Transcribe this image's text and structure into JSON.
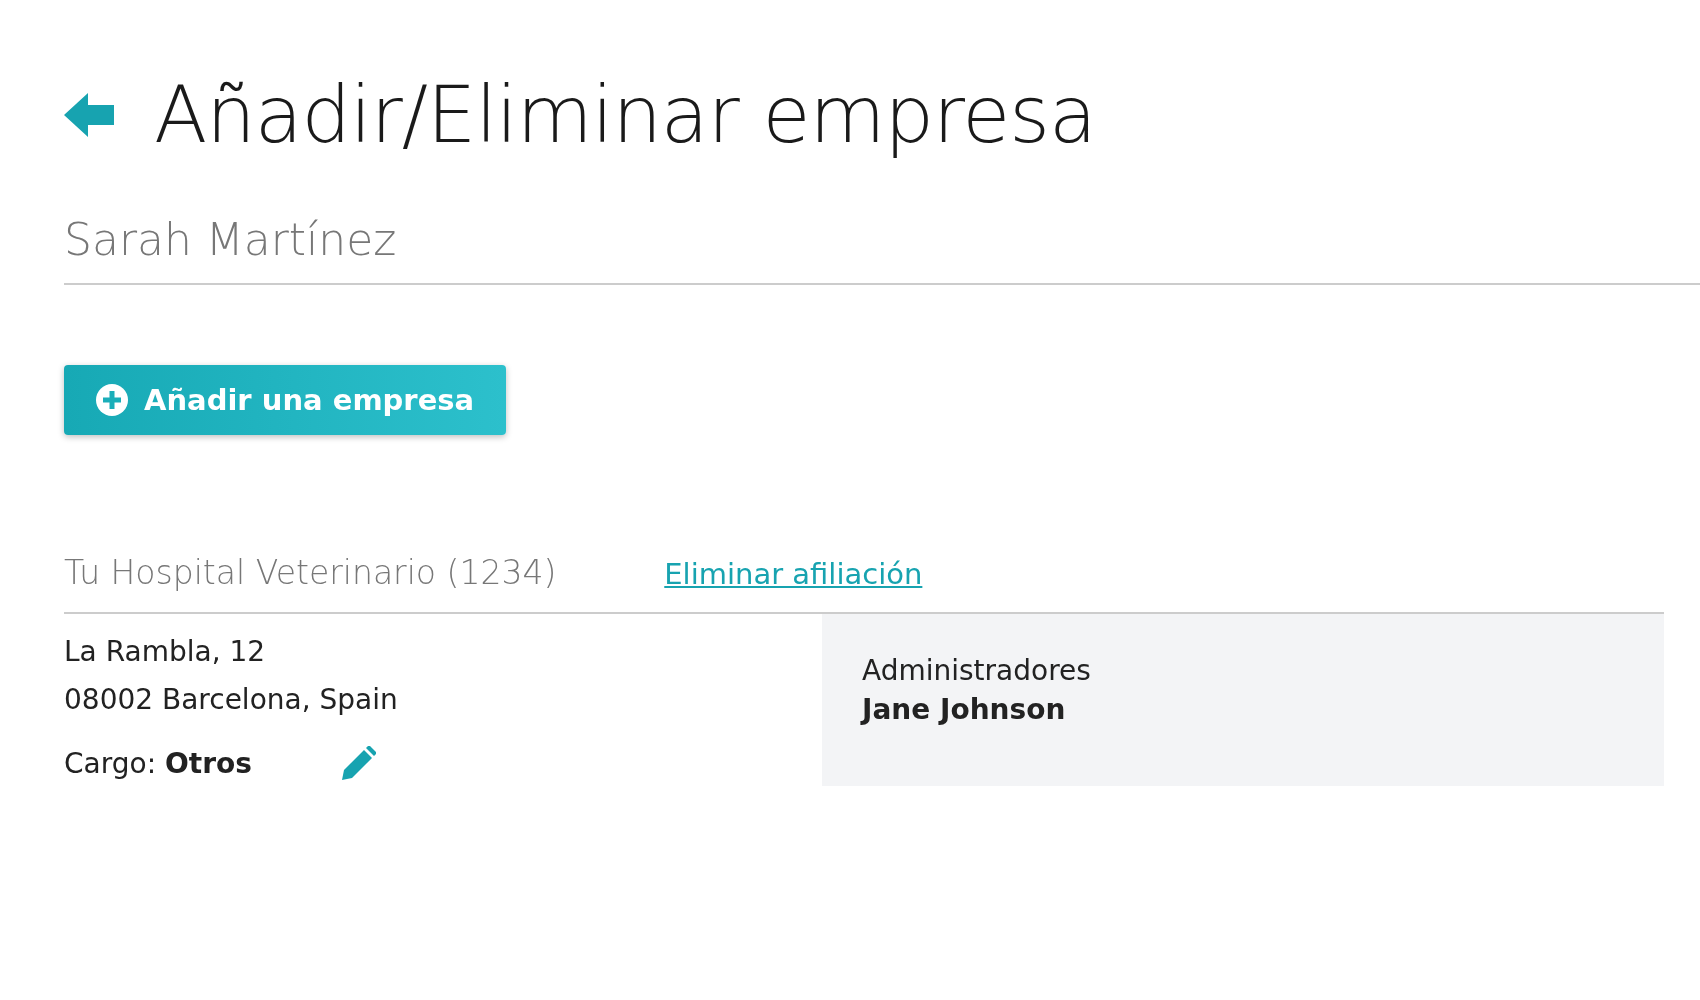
{
  "header": {
    "title": "Añadir/Eliminar empresa"
  },
  "user": {
    "name": "Sarah Martínez"
  },
  "add_button": {
    "label": "Añadir una empresa"
  },
  "affiliations": [
    {
      "company": "Tu Hospital Veterinario (1234)",
      "remove_link": "Eliminar afiliación",
      "address": [
        "La Rambla, 12",
        "08002 Barcelona, Spain"
      ],
      "role": "Cargo: **Otros**",
      "admins_label": "Administradores",
      "admins": [
        "Jane Johnson"
      ]
    }
  ]
}
